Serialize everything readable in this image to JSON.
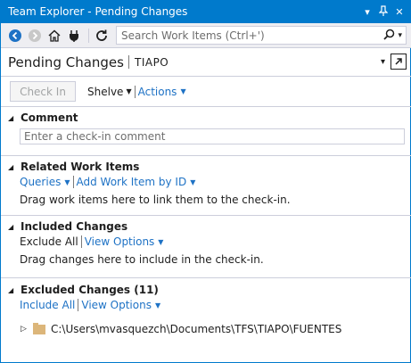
{
  "window": {
    "title": "Team Explorer - Pending Changes",
    "controls": [
      "dropdown-icon",
      "pin-icon",
      "close-icon"
    ]
  },
  "toolbar": {
    "icons": [
      "back-icon",
      "forward-icon",
      "home-icon",
      "connect-icon",
      "refresh-icon"
    ],
    "search_placeholder": "Search Work Items (Ctrl+')"
  },
  "header": {
    "title": "Pending Changes",
    "context": "TIAPO"
  },
  "actions": {
    "checkin_label": "Check In",
    "shelve_label": "Shelve",
    "actions_label": "Actions"
  },
  "sections": {
    "comment": {
      "title": "Comment",
      "placeholder": "Enter a check-in comment"
    },
    "related": {
      "title": "Related Work Items",
      "queries_label": "Queries",
      "add_label": "Add Work Item by ID",
      "hint": "Drag work items here to link them to the check-in."
    },
    "included": {
      "title": "Included Changes",
      "exclude_all_label": "Exclude All",
      "view_options_label": "View Options",
      "hint": "Drag changes here to include in the check-in."
    },
    "excluded": {
      "title": "Excluded Changes (11)",
      "include_all_label": "Include All",
      "view_options_label": "View Options",
      "path": "C:\\Users\\mvasquezch\\Documents\\TFS\\TIAPO\\FUENTES"
    }
  },
  "colors": {
    "accent": "#007acc",
    "link": "#1e72c5",
    "border": "#cccedb"
  }
}
